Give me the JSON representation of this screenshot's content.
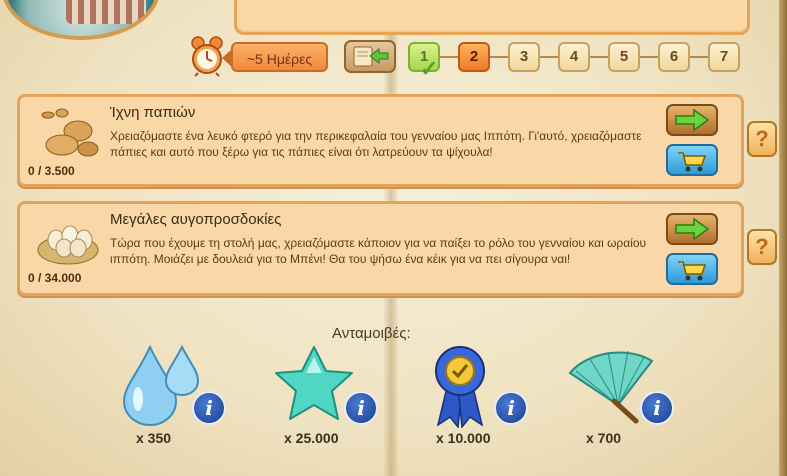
{
  "header": {
    "duration": "~5 Ημέρες"
  },
  "steps": [
    "1",
    "2",
    "3",
    "4",
    "5",
    "6",
    "7"
  ],
  "quests": [
    {
      "title": "Ίχνη παπιών",
      "description": "Χρειαζόμαστε ένα λευκό φτερό για την περικεφαλαία του γενναίου μας Ιππότη. Γι'αυτό, χρειαζόμαστε πάπιες και αυτό που ξέρω για τις πάπιες είναι ότι λατρεύουν τα ψίχουλα!",
      "progress": "0 / 3.500"
    },
    {
      "title": "Μεγάλες αυγοπροσδοκίες",
      "description": "Τώρα που έχουμε τη στολή μας, χρειαζόμαστε κάποιον για να παίξει το ρόλο του γενναίου και ωραίου ιππότη. Μοιάζει με δουλειά για το Μπένι! Θα του ψήσω ένα κέικ για να πει σίγουρα ναι!",
      "progress": "0 / 34.000"
    }
  ],
  "rewards_label": "Ανταμοιβές:",
  "rewards": [
    {
      "icon": "water-drops-icon",
      "amount": "x 350"
    },
    {
      "icon": "star-icon",
      "amount": "x 25.000"
    },
    {
      "icon": "ribbon-medal-icon",
      "amount": "x 10.000"
    },
    {
      "icon": "fan-icon",
      "amount": "x 700"
    }
  ],
  "colors": {
    "panel": "#fad7a6",
    "panel_border": "#e3a35a",
    "step_done": "#a7d64c",
    "step_current": "#f07a20",
    "info_blue": "#1a3f8f"
  }
}
